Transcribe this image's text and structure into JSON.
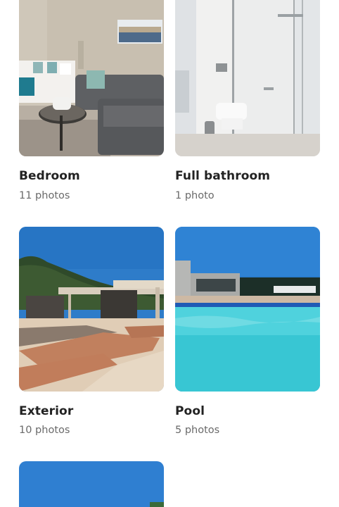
{
  "categories": [
    {
      "title": "Bedroom",
      "count": "11 photos"
    },
    {
      "title": "Full bathroom",
      "count": "1 photo"
    },
    {
      "title": "Exterior",
      "count": "10 photos"
    },
    {
      "title": "Pool",
      "count": "5 photos"
    },
    {
      "title": "",
      "count": ""
    }
  ]
}
